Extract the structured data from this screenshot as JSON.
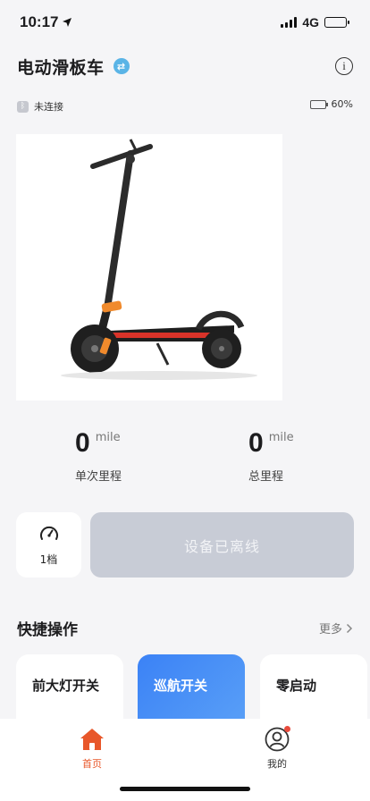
{
  "status_bar": {
    "time": "10:17",
    "network": "4G"
  },
  "header": {
    "title": "电动滑板车"
  },
  "connection": {
    "status": "未连接",
    "battery_percent": "60%"
  },
  "stats": {
    "trip": {
      "value": "0",
      "unit": "mile",
      "label": "单次里程"
    },
    "total": {
      "value": "0",
      "unit": "mile",
      "label": "总里程"
    }
  },
  "gear": {
    "label": "1档"
  },
  "device": {
    "offline_label": "设备已离线"
  },
  "quick": {
    "title": "快捷操作",
    "more": "更多",
    "items": [
      {
        "label": "前大灯开关"
      },
      {
        "label": "巡航开关"
      },
      {
        "label": "零启动"
      }
    ]
  },
  "tabs": [
    {
      "label": "首页",
      "active": true
    },
    {
      "label": "我的",
      "active": false
    }
  ],
  "colors": {
    "accent": "#e8572a",
    "primary_blue": "#3b82f6",
    "offline_gray": "#c8ccd6",
    "battery_green": "#49c36b"
  }
}
